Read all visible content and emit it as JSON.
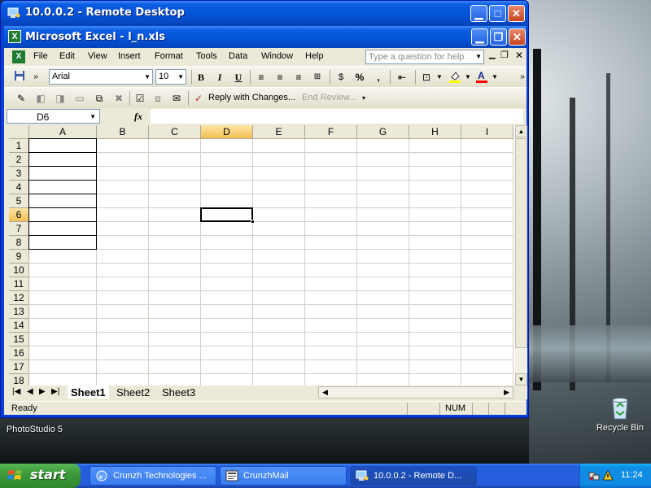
{
  "remote_desktop": {
    "title": "10.0.0.2 - Remote Desktop"
  },
  "excel": {
    "title": "Microsoft Excel - l_n.xls",
    "menu": [
      "File",
      "Edit",
      "View",
      "Insert",
      "Format",
      "Tools",
      "Data",
      "Window",
      "Help"
    ],
    "help_placeholder": "Type a question for help",
    "font_name": "Arial",
    "font_size": "10",
    "reply_with_changes": "Reply with Changes...",
    "end_review": "End Review...",
    "name_box": "D6",
    "fx_label": "fx",
    "columns": [
      "A",
      "B",
      "C",
      "D",
      "E",
      "F",
      "G",
      "H",
      "I"
    ],
    "rows": [
      "1",
      "2",
      "3",
      "4",
      "5",
      "6",
      "7",
      "8",
      "9",
      "10",
      "11",
      "12",
      "13",
      "14",
      "15",
      "16",
      "17",
      "18"
    ],
    "selected_cell": {
      "column": "D",
      "row": "6"
    },
    "outlined_range": "A1:A8",
    "sheets": [
      "Sheet1",
      "Sheet2",
      "Sheet3"
    ],
    "active_sheet": "Sheet1",
    "status": {
      "left": "Ready",
      "num": "NUM"
    }
  },
  "desktop": {
    "icons": [
      {
        "label": "PhotoStudio 5"
      },
      {
        "label": "Recycle Bin"
      }
    ]
  },
  "taskbar": {
    "start_label": "start",
    "tasks": [
      {
        "label": "Crunzh Technologies ..."
      },
      {
        "label": "CrunzhMail"
      },
      {
        "label": "10.0.0.2 - Remote D..."
      }
    ],
    "active_task": "10.0.0.2 - Remote D...",
    "clock": "11:24"
  },
  "colors": {
    "xp_blue": "#0453d6",
    "start_green": "#3c9a3a",
    "selection_header": "#f4bf55"
  }
}
